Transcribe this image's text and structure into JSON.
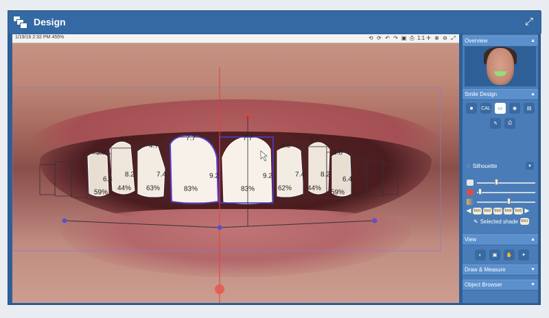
{
  "window": {
    "title": "Design"
  },
  "canvas": {
    "info": "1/19/16 2:32 PM  455%",
    "toolbar_icons": [
      "⟲",
      "⟳",
      "↶",
      "↷",
      "▣",
      "⎙",
      "1:1",
      "✛",
      "⊕",
      "⊖",
      "⤢"
    ],
    "measurements": [
      {
        "text": "3.7"
      },
      {
        "text": "4.7"
      },
      {
        "text": "7.7"
      },
      {
        "text": "7.7"
      },
      {
        "text": "4.6"
      },
      {
        "text": "3.7"
      },
      {
        "text": "3.8"
      },
      {
        "text": "3.8"
      },
      {
        "text": "6.4"
      },
      {
        "text": "8.2"
      },
      {
        "text": "7.4"
      },
      {
        "text": "9.2"
      },
      {
        "text": "9.2"
      },
      {
        "text": "7.4"
      },
      {
        "text": "8.2"
      },
      {
        "text": "6.4"
      },
      {
        "text": "59%"
      },
      {
        "text": "44%"
      },
      {
        "text": "63%"
      },
      {
        "text": "83%"
      },
      {
        "text": "83%"
      },
      {
        "text": "62%"
      },
      {
        "text": "44%"
      },
      {
        "text": "59%"
      }
    ]
  },
  "panel": {
    "overview": {
      "label": "Overview"
    },
    "smile_design": {
      "label": "Smile Design",
      "tool_row1": [
        "tooth-icon",
        "CAL",
        "ruler-icon",
        "eye-icon",
        "camera-icon"
      ],
      "tool_row2": [
        "brush-icon",
        "printer-icon"
      ],
      "silhouette_label": "Silhouette",
      "sliders": [
        0.32,
        0.02,
        0.55
      ],
      "shades": [
        "BM1",
        "BM2",
        "BM3",
        "BM4",
        "BM5"
      ],
      "selected_shade_label": "Selected shade",
      "selected_shade": "BM1"
    },
    "view": {
      "label": "View"
    },
    "draw_measure": {
      "label": "Draw & Measure"
    },
    "object_browser": {
      "label": "Object Browser"
    }
  },
  "colors": {
    "window_blue": "#2e5f96",
    "panel_blue": "#4a7db8",
    "guide_red": "#e53e3e",
    "outline_blue": "#4b3fd0"
  }
}
